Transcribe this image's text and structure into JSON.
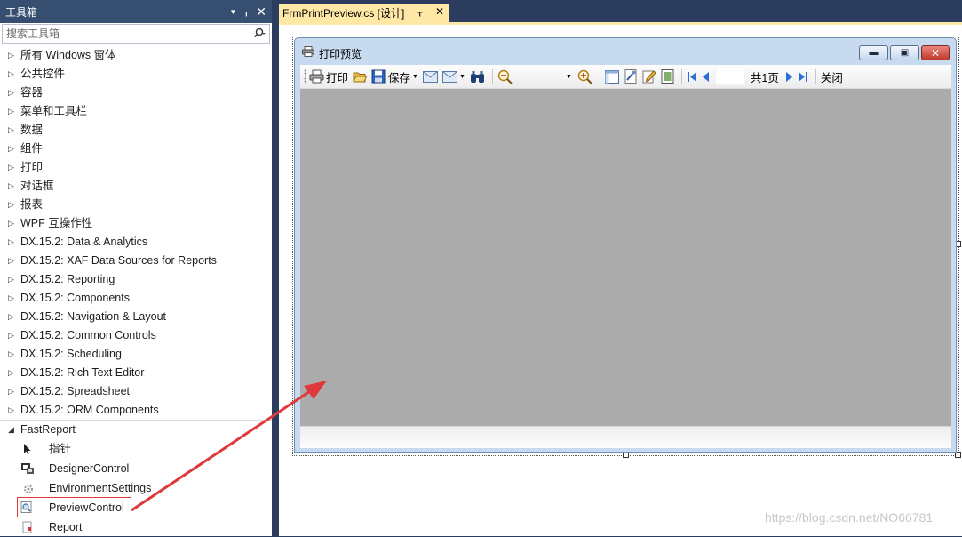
{
  "toolbox": {
    "title": "工具箱",
    "search_placeholder": "搜索工具箱",
    "categories": [
      {
        "label": "所有 Windows 窗体"
      },
      {
        "label": "公共控件"
      },
      {
        "label": "容器"
      },
      {
        "label": "菜单和工具栏"
      },
      {
        "label": "数据"
      },
      {
        "label": "组件"
      },
      {
        "label": "打印"
      },
      {
        "label": "对话框"
      },
      {
        "label": "报表"
      },
      {
        "label": "WPF 互操作性"
      },
      {
        "label": "DX.15.2: Data & Analytics"
      },
      {
        "label": "DX.15.2: XAF Data Sources for Reports"
      },
      {
        "label": "DX.15.2: Reporting"
      },
      {
        "label": "DX.15.2: Components"
      },
      {
        "label": "DX.15.2: Navigation & Layout"
      },
      {
        "label": "DX.15.2: Common Controls"
      },
      {
        "label": "DX.15.2: Scheduling"
      },
      {
        "label": "DX.15.2: Rich Text Editor"
      },
      {
        "label": "DX.15.2: Spreadsheet"
      },
      {
        "label": "DX.15.2: ORM Components"
      }
    ],
    "expanded_category": "FastReport",
    "tools": [
      {
        "label": "指针",
        "icon": "pointer-icon"
      },
      {
        "label": "DesignerControl",
        "icon": "designer-control-icon"
      },
      {
        "label": "EnvironmentSettings",
        "icon": "settings-gear-icon"
      },
      {
        "label": "PreviewControl",
        "icon": "preview-magnifier-icon"
      },
      {
        "label": "Report",
        "icon": "report-icon"
      }
    ]
  },
  "document": {
    "tab_label": "FrmPrintPreview.cs [设计]",
    "form": {
      "title": "打印预览",
      "toolbar": {
        "print": "打印",
        "save": "保存",
        "page_total": "共1页",
        "close": "关闭"
      }
    }
  },
  "watermark": "https://blog.csdn.net/NO66781",
  "colors": {
    "ide_background": "#2b3c5e",
    "toolbox_title": "#364e6f",
    "active_tab": "#ffe8a6",
    "preview_area": "#ababab",
    "form_frame": "#c7daf0",
    "annotation": "#e0393b"
  }
}
